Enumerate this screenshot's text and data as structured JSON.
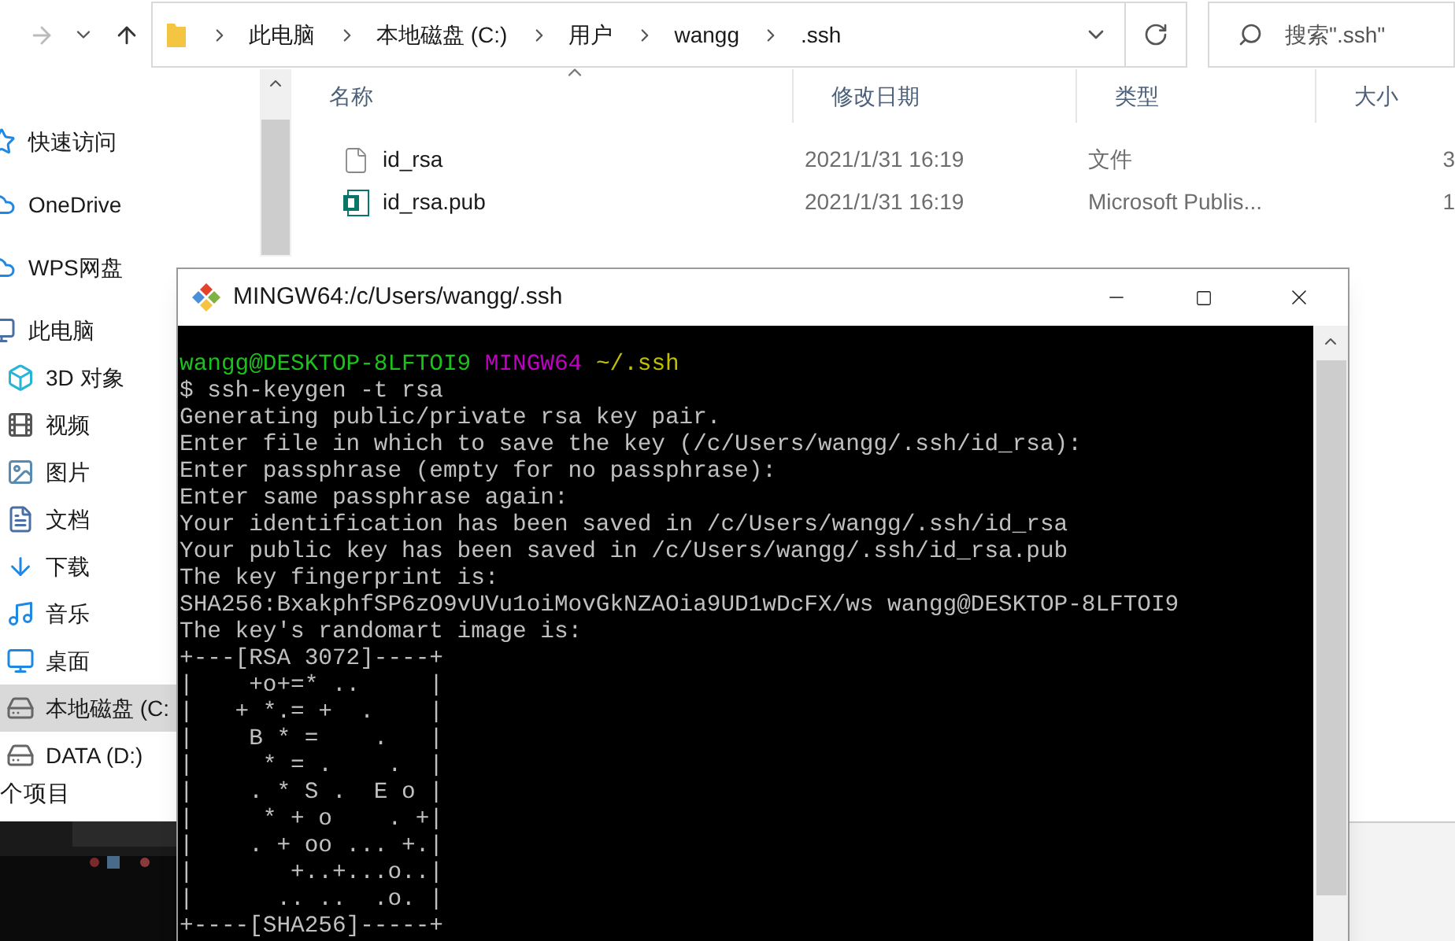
{
  "explorer": {
    "nav": {
      "forward_disabled": true
    },
    "address": {
      "crumbs": [
        "此电脑",
        "本地磁盘 (C:)",
        "用户",
        "wangg",
        ".ssh"
      ]
    },
    "search": {
      "placeholder": "搜索\".ssh\""
    },
    "columns": [
      {
        "label": "名称",
        "sorted": true
      },
      {
        "label": "修改日期",
        "sorted": false
      },
      {
        "label": "类型",
        "sorted": false
      },
      {
        "label": "大小",
        "sorted": false
      }
    ],
    "files": [
      {
        "kind": "file",
        "name": "id_rsa",
        "modified": "2021/1/31 16:19",
        "type": "文件",
        "size": "3"
      },
      {
        "kind": "publisher",
        "name": "id_rsa.pub",
        "modified": "2021/1/31 16:19",
        "type": "Microsoft Publis...",
        "size": "1"
      }
    ],
    "sidebar": {
      "items": [
        {
          "label": "快速访问",
          "selected": false
        },
        {
          "label": "OneDrive",
          "selected": false
        },
        {
          "label": "WPS网盘",
          "selected": false
        },
        {
          "label": "此电脑",
          "selected": false,
          "children": [
            {
              "label": "3D 对象",
              "selected": false
            },
            {
              "label": "视频",
              "selected": false
            },
            {
              "label": "图片",
              "selected": false
            },
            {
              "label": "文档",
              "selected": false
            },
            {
              "label": "下载",
              "selected": false
            },
            {
              "label": "音乐",
              "selected": false
            },
            {
              "label": "桌面",
              "selected": false
            },
            {
              "label": "本地磁盘 (C:",
              "selected": true
            },
            {
              "label": "DATA (D:)",
              "selected": false
            }
          ]
        }
      ]
    },
    "status_bar": "个项目"
  },
  "terminal": {
    "title": "MINGW64:/c/Users/wangg/.ssh",
    "lines": [
      {
        "kind": "prompt",
        "user": "wangg@DESKTOP-8LFTOI9",
        "shell": "MINGW64",
        "path": "~/.ssh"
      },
      {
        "kind": "text",
        "text": "$ ssh-keygen -t rsa"
      },
      {
        "kind": "text",
        "text": "Generating public/private rsa key pair."
      },
      {
        "kind": "text",
        "text": "Enter file in which to save the key (/c/Users/wangg/.ssh/id_rsa):"
      },
      {
        "kind": "text",
        "text": "Enter passphrase (empty for no passphrase):"
      },
      {
        "kind": "text",
        "text": "Enter same passphrase again:"
      },
      {
        "kind": "text",
        "text": "Your identification has been saved in /c/Users/wangg/.ssh/id_rsa"
      },
      {
        "kind": "text",
        "text": "Your public key has been saved in /c/Users/wangg/.ssh/id_rsa.pub"
      },
      {
        "kind": "text",
        "text": "The key fingerprint is:"
      },
      {
        "kind": "text",
        "text": "SHA256:BxakphfSP6zO9vUVu1oiMovGkNZAOia9UD1wDcFX/ws wangg@DESKTOP-8LFTOI9"
      },
      {
        "kind": "text",
        "text": "The key's randomart image is:"
      },
      {
        "kind": "text",
        "text": "+---[RSA 3072]----+"
      },
      {
        "kind": "text",
        "text": "|    +o+=* ..     |"
      },
      {
        "kind": "text",
        "text": "|   + *.= +  .    |"
      },
      {
        "kind": "text",
        "text": "|    B * =    .   |"
      },
      {
        "kind": "text",
        "text": "|     * = .    .  |"
      },
      {
        "kind": "text",
        "text": "|    . * S .  E o |"
      },
      {
        "kind": "text",
        "text": "|     * + o    . +|"
      },
      {
        "kind": "text",
        "text": "|    . + oo ... +.|"
      },
      {
        "kind": "text",
        "text": "|       +..+...o..|"
      },
      {
        "kind": "text",
        "text": "|      .. ..  .o. |"
      },
      {
        "kind": "text",
        "text": "+----[SHA256]-----+"
      }
    ]
  }
}
